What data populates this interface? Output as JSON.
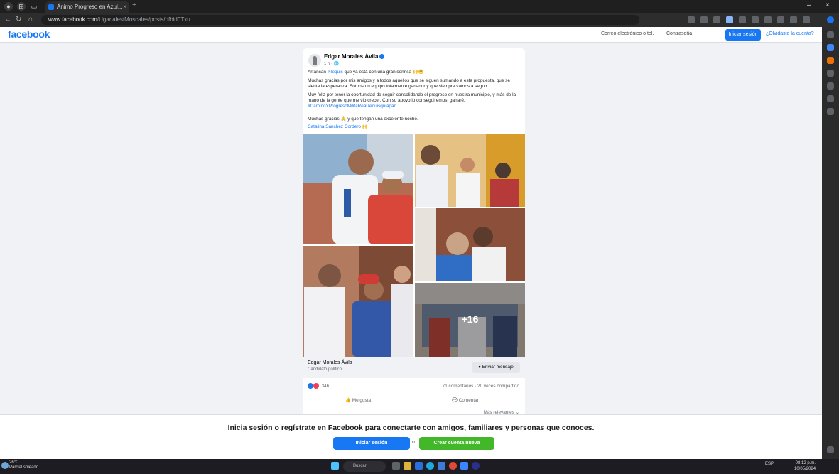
{
  "browser": {
    "tab_title": "Ánimo Progreso en Azul...",
    "tab_close": "×",
    "new_tab": "+",
    "url_host": "www.facebook.com",
    "url_rest": "/Ugar.alestMoscales/posts/pfbid0Txu...",
    "win_min": "–",
    "win_close": "×"
  },
  "header": {
    "logo": "facebook",
    "link_forgot_account": "Correo electrónico o tel.",
    "link_password": "Contraseña",
    "login_button": "Iniciar sesión",
    "forgot_link": "¿Olvidaste la cuenta?"
  },
  "post": {
    "author": "Edgar Morales Ávila",
    "time": "1 h · 🌐",
    "line1_prefix": "Arrancan ",
    "line1_link": "#Tequis",
    "line1_suffix": " que ya está con una gran sonrisa 🙌😁",
    "paragraph2": "Muchas gracias por mis amigos y a todos aquellos que se siguen sumando a esta propuesta, que se sienta la esperanza. Somos un equipo totalmente ganador y que siempre vamos a seguir.",
    "paragraph3_text": "Muy feliz por tener la oportunidad de seguir consolidando el progreso en nuestra municipio, y más de la mano de la gente que me vio crecer. Con su apoyo lo conseguiremos, ganaré.",
    "paragraph3_link": "#CaminoYProgresoMilitaRealTequisquiapan",
    "line4": "Muchas gracias 🙏 y que tengan una excelente noche.",
    "line5": "Catalina Sánchez Cordero 🙌",
    "more_photos": "+16",
    "page_name": "Edgar Morales Ávila",
    "page_sub": "Candidato político",
    "send_message": "Enviar mensaje",
    "reaction_count": "346",
    "counts": "71 comentarios · 20 veces compartido",
    "like": "Me gusta",
    "comment": "Comentar",
    "relevant": "Más relevantes ⌄"
  },
  "banner": {
    "text": "Inicia sesión o regístrate en Facebook para conectarte con amigos, familiares y personas que conoces.",
    "login": "Iniciar sesión",
    "or": "o",
    "create": "Crear cuenta nueva"
  },
  "taskbar": {
    "weather_temp": "26°C",
    "weather_desc": "Parcial soleado",
    "search": "Buscar",
    "tray": "ESP",
    "time": "08:12 p.m.",
    "date": "10/05/2024"
  },
  "colors": {
    "fb_blue": "#1877f2",
    "fb_green": "#42b72a",
    "bg": "#f0f2f5"
  }
}
